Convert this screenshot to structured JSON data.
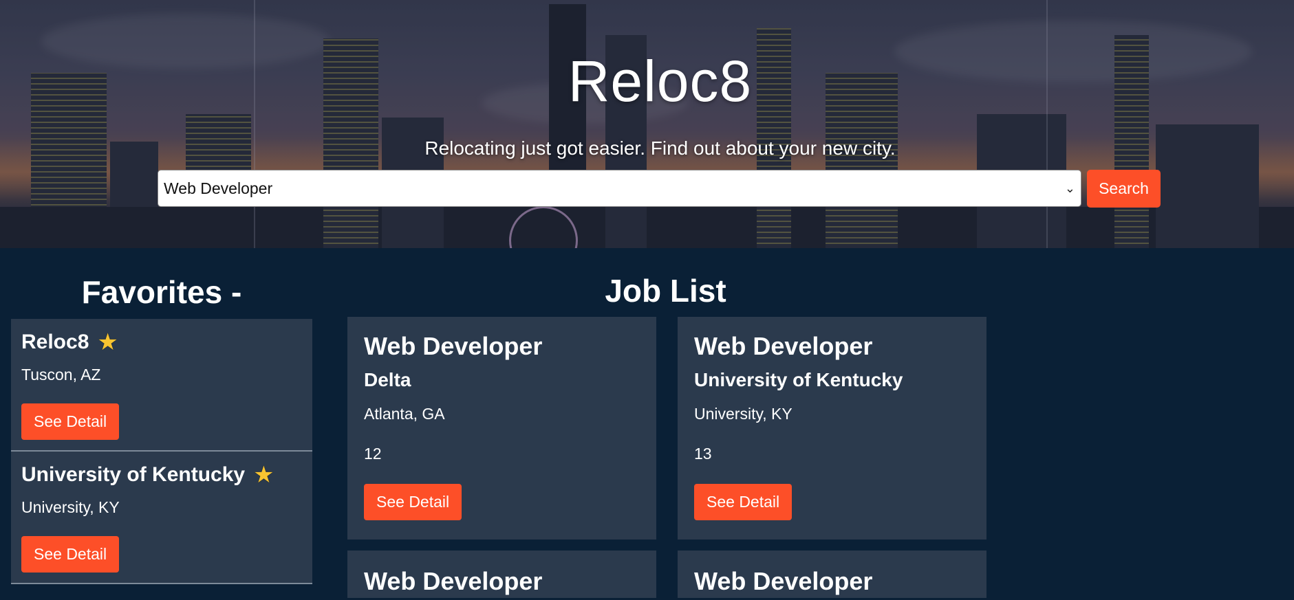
{
  "hero": {
    "title": "Reloc8",
    "tagline": "Relocating just got easier. Find out about your new city.",
    "search_select_value": "Web Developer",
    "search_button": "Search"
  },
  "favorites": {
    "heading": "Favorites -",
    "items": [
      {
        "name": "Reloc8",
        "location": "Tuscon, AZ",
        "button": "See Detail",
        "star_icon": "star-icon"
      },
      {
        "name": "University of Kentucky",
        "location": "University, KY",
        "button": "See Detail",
        "star_icon": "star-icon"
      }
    ]
  },
  "jobs": {
    "heading": "Job List",
    "items": [
      {
        "title": "Web Developer",
        "company": "Delta",
        "location": "Atlanta, GA",
        "number": "12",
        "button": "See Detail"
      },
      {
        "title": "Web Developer",
        "company": "University of Kentucky",
        "location": "University, KY",
        "number": "13",
        "button": "See Detail"
      },
      {
        "title": "Web Developer"
      },
      {
        "title": "Web Developer"
      }
    ]
  },
  "colors": {
    "page_bg": "#0a2036",
    "card_bg": "#2b3a4d",
    "accent": "#fd4f28",
    "star": "#f8c431"
  }
}
